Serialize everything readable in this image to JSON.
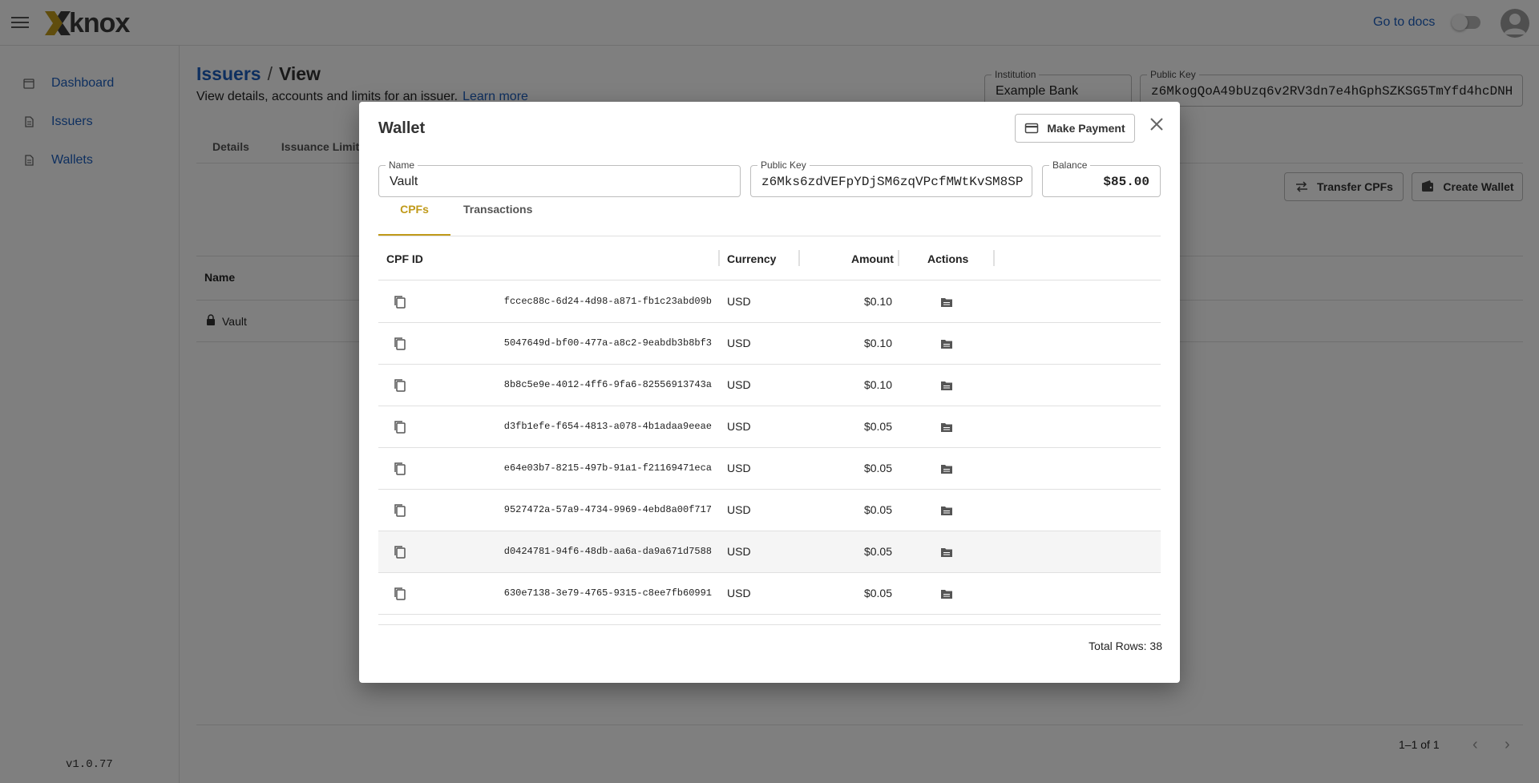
{
  "app": {
    "brand": "knox",
    "go_docs": "Go to docs",
    "version": "v1.0.77"
  },
  "sidebar": {
    "items": [
      {
        "label": "Dashboard"
      },
      {
        "label": "Issuers"
      },
      {
        "label": "Wallets"
      }
    ]
  },
  "page": {
    "crumb_link": "Issuers",
    "crumb_sep": "/",
    "crumb_current": "View",
    "subtitle": "View details, accounts and limits for an issuer.",
    "learn_more": "Learn more",
    "institution_label": "Institution",
    "institution_value": "Example Bank",
    "public_key_label": "Public Key",
    "public_key_value": "z6MkogQoA49bUzq6v2RV3dn7e4hGphSZKSG5TmYfd4hcDNH",
    "tabs": [
      {
        "label": "Details"
      },
      {
        "label": "Issuance Limit"
      }
    ],
    "transfer_btn": "Transfer CPFs",
    "create_wallet_btn": "Create Wallet",
    "grid_header_name": "Name",
    "grid_row_name": "Vault",
    "pager_text": "1–1 of 1"
  },
  "modal": {
    "title": "Wallet",
    "make_payment": "Make Payment",
    "name_label": "Name",
    "name_value": "Vault",
    "pk_label": "Public Key",
    "pk_value": "z6Mks6zdVEFpYDjSM6zqVPcfMWtKvSM8SP",
    "balance_label": "Balance",
    "balance_value": "$85.00",
    "tabs": [
      {
        "label": "CPFs"
      },
      {
        "label": "Transactions"
      }
    ],
    "columns": {
      "cpf_id": "CPF ID",
      "currency": "Currency",
      "amount": "Amount",
      "actions": "Actions"
    },
    "rows": [
      {
        "id": "fccec88c-6d24-4d98-a871-fb1c23abd09b",
        "currency": "USD",
        "amount": "$0.10"
      },
      {
        "id": "5047649d-bf00-477a-a8c2-9eabdb3b8bf3",
        "currency": "USD",
        "amount": "$0.10"
      },
      {
        "id": "8b8c5e9e-4012-4ff6-9fa6-82556913743a",
        "currency": "USD",
        "amount": "$0.10"
      },
      {
        "id": "d3fb1efe-f654-4813-a078-4b1adaa9eeae",
        "currency": "USD",
        "amount": "$0.05"
      },
      {
        "id": "e64e03b7-8215-497b-91a1-f21169471eca",
        "currency": "USD",
        "amount": "$0.05"
      },
      {
        "id": "9527472a-57a9-4734-9969-4ebd8a00f717",
        "currency": "USD",
        "amount": "$0.05"
      },
      {
        "id": "d0424781-94f6-48db-aa6a-da9a671d7588",
        "currency": "USD",
        "amount": "$0.05"
      },
      {
        "id": "630e7138-3e79-4765-9315-c8ee7fb60991",
        "currency": "USD",
        "amount": "$0.05"
      }
    ],
    "total_rows": "Total Rows: 38"
  },
  "colors": {
    "link": "#1c5fbf",
    "accent": "#c09a1a",
    "overlay": "rgba(0,0,0,0.5)"
  }
}
